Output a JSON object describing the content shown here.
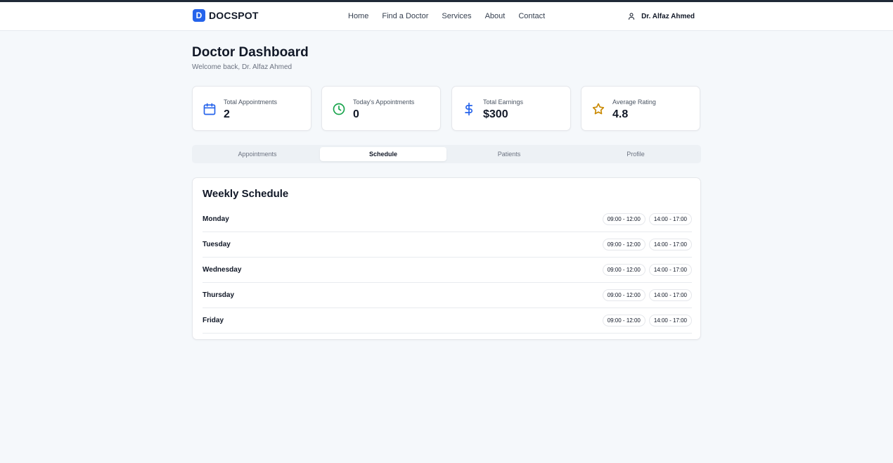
{
  "header": {
    "logo_letter": "D",
    "brand": "DOCSPOT",
    "nav": [
      "Home",
      "Find a Doctor",
      "Services",
      "About",
      "Contact"
    ],
    "user_name": "Dr. Alfaz Ahmed"
  },
  "page": {
    "title": "Doctor Dashboard",
    "subtitle": "Welcome back, Dr. Alfaz Ahmed"
  },
  "stats": [
    {
      "label": "Total Appointments",
      "value": "2",
      "icon": "calendar-icon",
      "color": "#2563eb"
    },
    {
      "label": "Today's Appointments",
      "value": "0",
      "icon": "clock-icon",
      "color": "#16a34a"
    },
    {
      "label": "Total Earnings",
      "value": "$300",
      "icon": "dollar-icon",
      "color": "#2563eb"
    },
    {
      "label": "Average Rating",
      "value": "4.8",
      "icon": "star-icon",
      "color": "#ca8a04"
    }
  ],
  "tabs": [
    {
      "label": "Appointments",
      "active": false
    },
    {
      "label": "Schedule",
      "active": true
    },
    {
      "label": "Patients",
      "active": false
    },
    {
      "label": "Profile",
      "active": false
    }
  ],
  "schedule": {
    "title": "Weekly Schedule",
    "days": [
      {
        "day": "Monday",
        "slots": [
          "09:00 - 12:00",
          "14:00 - 17:00"
        ]
      },
      {
        "day": "Tuesday",
        "slots": [
          "09:00 - 12:00",
          "14:00 - 17:00"
        ]
      },
      {
        "day": "Wednesday",
        "slots": [
          "09:00 - 12:00",
          "14:00 - 17:00"
        ]
      },
      {
        "day": "Thursday",
        "slots": [
          "09:00 - 12:00",
          "14:00 - 17:00"
        ]
      },
      {
        "day": "Friday",
        "slots": [
          "09:00 - 12:00",
          "14:00 - 17:00"
        ]
      }
    ]
  }
}
